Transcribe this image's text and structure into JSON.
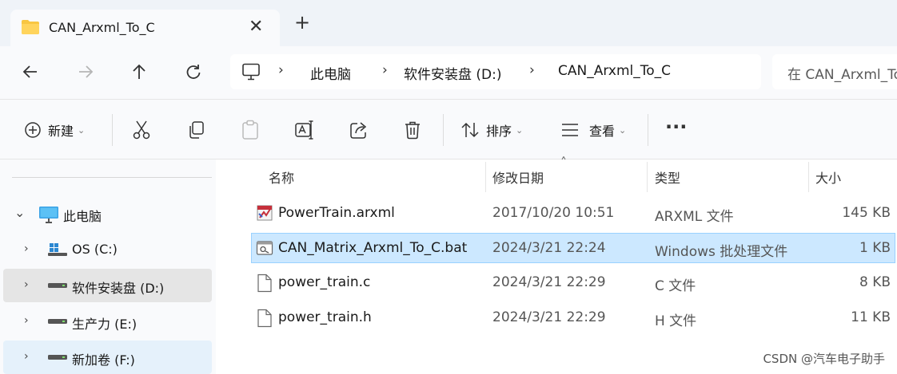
{
  "window": {
    "tab_title": "CAN_Arxml_To_C",
    "tab_close": "✕",
    "new_tab": "+"
  },
  "nav": {
    "breadcrumb": [
      "此电脑",
      "软件安装盘 (D:)",
      "CAN_Arxml_To_C"
    ],
    "search_placeholder": "在 CAN_Arxml_To_C 中搜索"
  },
  "toolbar": {
    "new_label": "新建",
    "sort_label": "排序",
    "view_label": "查看",
    "more": "···"
  },
  "sidebar": {
    "items": [
      {
        "label": "此电脑",
        "expanded": true,
        "selected": false,
        "icon": "pc-icon"
      },
      {
        "label": "OS (C:)",
        "expanded": false,
        "selected": false,
        "icon": "windows-drive-icon"
      },
      {
        "label": "软件安装盘 (D:)",
        "expanded": false,
        "selected": true,
        "icon": "drive-icon"
      },
      {
        "label": "生产力 (E:)",
        "expanded": false,
        "selected": false,
        "icon": "drive-icon"
      },
      {
        "label": "新加卷 (F:)",
        "expanded": false,
        "selected": false,
        "hover": true,
        "icon": "drive-icon"
      }
    ]
  },
  "columns": {
    "name": "名称",
    "date": "修改日期",
    "type": "类型",
    "size": "大小"
  },
  "files": [
    {
      "name": "PowerTrain.arxml",
      "date": "2017/10/20 10:51",
      "type": "ARXML 文件",
      "size": "145 KB",
      "icon": "arxml-file-icon",
      "selected": false
    },
    {
      "name": "CAN_Matrix_Arxml_To_C.bat",
      "date": "2024/3/21 22:24",
      "type": "Windows 批处理文件",
      "size": "1 KB",
      "icon": "batch-file-icon",
      "selected": true
    },
    {
      "name": "power_train.c",
      "date": "2024/3/21 22:29",
      "type": "C 文件",
      "size": "8 KB",
      "icon": "file-icon",
      "selected": false
    },
    {
      "name": "power_train.h",
      "date": "2024/3/21 22:29",
      "type": "H 文件",
      "size": "11 KB",
      "icon": "file-icon",
      "selected": false
    }
  ],
  "watermark": "CSDN @汽车电子助手",
  "colors": {
    "selected_row": "#cce8ff",
    "selected_border": "#99d1ff",
    "sidebar_selected": "#e5e5e5",
    "sidebar_hover": "#e5f1fb",
    "folder": "#f8c642"
  }
}
